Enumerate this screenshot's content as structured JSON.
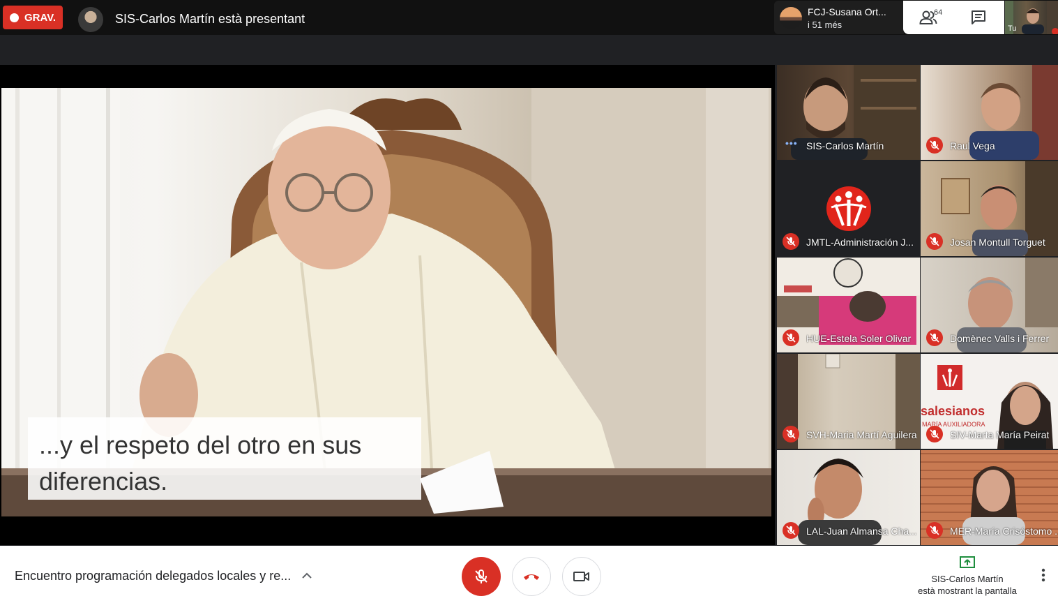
{
  "topbar": {
    "recording_label": "GRAV.",
    "presenting_text": "SIS-Carlos Martín està presentant",
    "notification": {
      "name": "FCJ-Susana Ort...",
      "sub": "i 51 més"
    },
    "participant_count": "64",
    "self_label": "Tu"
  },
  "main": {
    "caption_line1": "...y el respeto del otro en sus",
    "caption_line2": "diferencias."
  },
  "participants": [
    {
      "name": "SIS-Carlos Martín",
      "muted": false,
      "speaking": true
    },
    {
      "name": "Raul Vega",
      "muted": true
    },
    {
      "name": "JMTL-Administración J...",
      "muted": true
    },
    {
      "name": "Josan Montull Torguet",
      "muted": true
    },
    {
      "name": "HUE-Estela Soler Olivar",
      "muted": true
    },
    {
      "name": "Domènec Valls i Ferrer",
      "muted": true
    },
    {
      "name": "SVH-Maria Martí Aguilera",
      "muted": true
    },
    {
      "name": "SIV-Marta María Peirat",
      "muted": true
    },
    {
      "name": "LAL-Juan Almansa Cha...",
      "muted": true
    },
    {
      "name": "MER-María Crisóstomo ...",
      "muted": true
    }
  ],
  "tile_text": {
    "salesianos": "salesianos",
    "maria_auxiliadora": "MARÍA AUXILIADORA"
  },
  "bottombar": {
    "meeting_title": "Encuentro programación delegados locales y re...",
    "share_line1": "SIS-Carlos Martín",
    "share_line2": "està mostrant la pantalla"
  },
  "colors": {
    "accent_red": "#d93025",
    "speaking_blue": "#8ab4f8",
    "dark_bg": "#202124"
  }
}
